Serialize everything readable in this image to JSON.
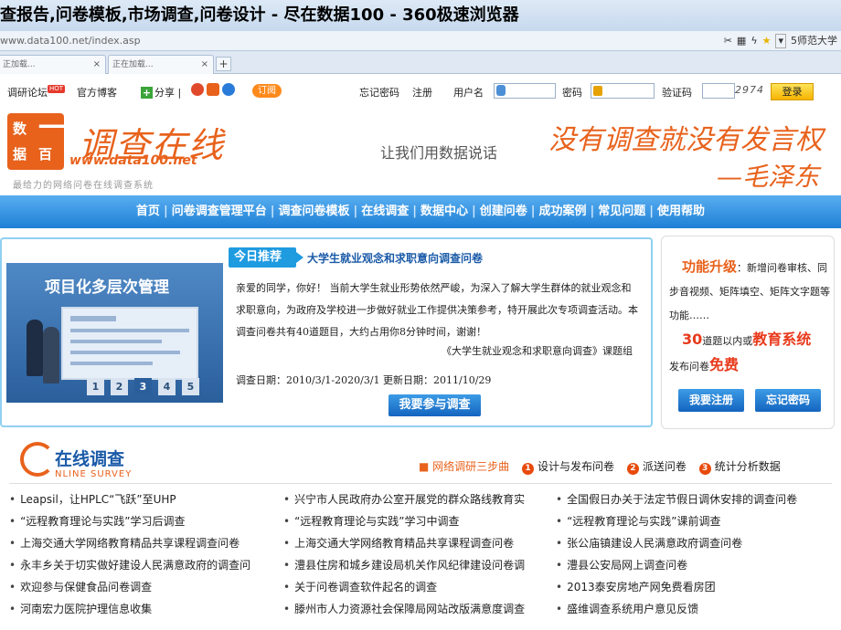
{
  "window": {
    "title": "查报告,问卷模板,市场调查,问卷设计 - 尽在数据100 - 360极速浏览器"
  },
  "address": {
    "url": "www.data100.net/index.asp",
    "right_label": "5师范大学"
  },
  "tabs": [
    {
      "label": "正加载..."
    },
    {
      "label": "正在加载..."
    }
  ],
  "topbar": {
    "forum": "调研论坛",
    "hot": "HOT",
    "blog": "官方博客",
    "share": "分享",
    "subscribe": "订阅",
    "forgot": "忘记密码",
    "register": "注册",
    "username_label": "用户名",
    "password_label": "密码",
    "captcha_label": "验证码",
    "captcha_value": "2974",
    "login": "登录"
  },
  "header": {
    "logo_chars": [
      "数",
      "据",
      "一",
      "百"
    ],
    "logo_name": "调查在线",
    "logo_url": "www.data100.net",
    "tagline": "最给力的网络问卷在线调查系统",
    "slogan": "让我们用数据说话",
    "calligraphy_1": "没有调查就没有发言权",
    "calligraphy_2": "—毛泽东"
  },
  "nav": [
    "首页",
    "问卷调查管理平台",
    "调查问卷模板",
    "在线调查",
    "数据中心",
    "创建问卷",
    "成功案例",
    "常见问题",
    "使用帮助"
  ],
  "feature": {
    "slide_title": "项目化多层次管理",
    "pages": [
      "1",
      "2",
      "3",
      "4",
      "5"
    ],
    "active_page": 3,
    "tag": "今日推荐",
    "title": "大学生就业观念和求职意向调查问卷",
    "body": "亲爱的同学，你好！ 当前大学生就业形势依然严峻，为深入了解大学生群体的就业观念和求职意向，为政府及学校进一步做好就业工作提供决策参考，特开展此次专项调查活动。本调查问卷共有40道题目，大约占用你8分钟时间，谢谢！",
    "signature": "《大学生就业观念和求职意向调查》课题组",
    "dates": "调查日期：2010/3/1-2020/3/1  更新日期：2011/10/29",
    "button": "我要参与调查"
  },
  "side": {
    "heading": "功能升级",
    "text1": "：新增问卷审核、同步音视频、矩阵填空、矩阵文字题等功能……",
    "limit_num": "30",
    "limit_text": "道题以内或",
    "edu": "教育系统",
    "publish": "发布问卷",
    "free": "免费",
    "register_btn": "我要注册",
    "forgot_btn": "忘记密码"
  },
  "survey": {
    "title": "在线调查",
    "subtitle": "NLINE SURVEY",
    "steps_lead": "网络调研三步曲",
    "steps": [
      "设计与发布问卷",
      "派送问卷",
      "统计分析数据"
    ],
    "items": [
      [
        "Leapsil，让HPLC“飞跃”至UHP",
        "兴宁市人民政府办公室开展党的群众路线教育实",
        "全国假日办关于法定节假日调休安排的调查问卷"
      ],
      [
        "“远程教育理论与实践”学习后调查",
        "“远程教育理论与实践”学习中调查",
        "“远程教育理论与实践”课前调查"
      ],
      [
        "上海交通大学网络教育精品共享课程调查问卷",
        "上海交通大学网络教育精品共享课程调查问卷",
        "张公庙镇建设人民满意政府调查问卷"
      ],
      [
        "永丰乡关于切实做好建设人民满意政府的调查问",
        "澧县住房和城乡建设局机关作风纪律建设问卷调",
        "澧县公安局网上调查问卷"
      ],
      [
        "欢迎参与保健食品问卷调查",
        "关于问卷调查软件起名的调查",
        "2013泰安房地产网免费看房团"
      ],
      [
        "河南宏力医院护理信息收集",
        "滕州市人力资源社会保障局网站改版满意度调查",
        "盛维调查系统用户意见反馈"
      ]
    ]
  }
}
